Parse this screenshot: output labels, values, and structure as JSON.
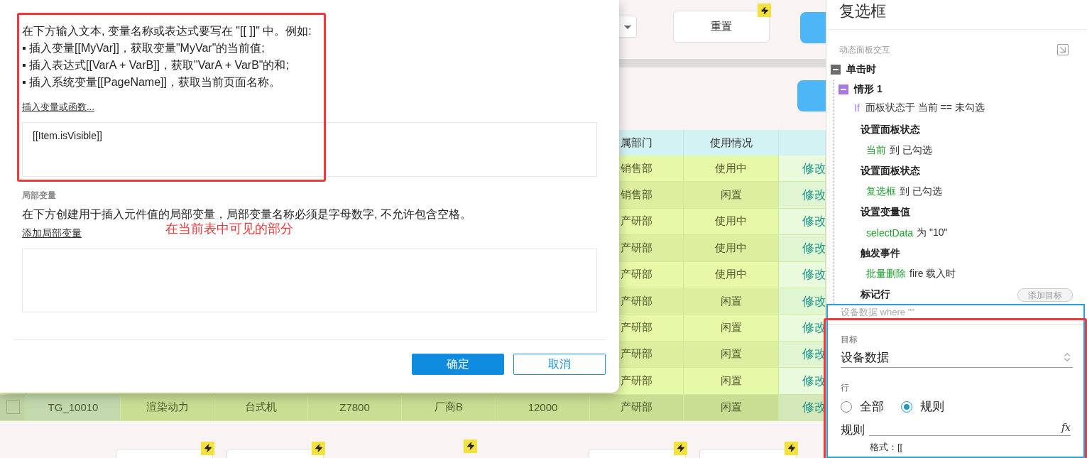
{
  "dialog": {
    "intro": [
      "在下方输入文本, 变量名称或表达式要写在 \"[[ ]]\" 中。例如:",
      "▪ 插入变量[[MyVar]]，获取变量\"MyVar\"的当前值;",
      "▪ 插入表达式[[VarA + VarB]]，获取\"VarA + VarB\"的和;",
      "▪ 插入系统变量[[PageName]]，获取当前页面名称。"
    ],
    "insert_link": "插入变量或函数...",
    "expression": "[[Item.isVisible]]",
    "local_vars_heading": "局部变量",
    "local_vars_desc": "在下方创建用于插入元件值的局部变量，局部变量名称必须是字母数字, 不允许包含空格。",
    "add_local_link": "添加局部变量",
    "buttons": [
      {
        "label": "确定",
        "kind": "primary"
      },
      {
        "label": "取消",
        "kind": "secondary"
      }
    ]
  },
  "annotation": "在当前表中可见的部分",
  "background": {
    "reset_button": "重置",
    "table": {
      "columns": [
        "属部门",
        "使用情况"
      ],
      "rows": [
        {
          "dept": "销售部",
          "status": "使用中",
          "action": "修改"
        },
        {
          "dept": "销售部",
          "status": "闲置",
          "action": "修改"
        },
        {
          "dept": "产研部",
          "status": "使用中",
          "action": "修改"
        },
        {
          "dept": "产研部",
          "status": "使用中",
          "action": "修改"
        },
        {
          "dept": "产研部",
          "status": "使用中",
          "action": "修改"
        },
        {
          "dept": "产研部",
          "status": "闲置",
          "action": "修改"
        },
        {
          "dept": "产研部",
          "status": "闲置",
          "action": "修改"
        },
        {
          "dept": "产研部",
          "status": "闲置",
          "action": "修改"
        },
        {
          "dept": "产研部",
          "status": "闲置",
          "action": "修改"
        },
        {
          "checked": false,
          "id": "TG_10010",
          "name": "渲染动力",
          "type": "台式机",
          "model": "Z7800",
          "vendor": "厂商B",
          "price": "12000",
          "dept": "产研部",
          "status": "闲置",
          "action": "修改"
        }
      ]
    }
  },
  "panel": {
    "title": "复选框",
    "section": "动态面板交互",
    "event": {
      "label": "单击时",
      "expanded": true,
      "case": {
        "label": "情形 1",
        "expanded": true,
        "keyword": "If",
        "condition": "面板状态于 当前 == 未勾选",
        "actions": [
          {
            "title": "设置面板状态",
            "target": "当前",
            "detail": "到 已勾选"
          },
          {
            "title": "设置面板状态",
            "target": "复选框",
            "detail": "到 已勾选"
          },
          {
            "title": "设置变量值",
            "target": "selectData",
            "detail": "为 \"10\""
          },
          {
            "title": "触发事件",
            "target": "批量删除",
            "detail": "fire 载入时"
          }
        ],
        "mark_row": {
          "title": "标记行",
          "button": "添加目标"
        }
      }
    },
    "editor": {
      "summary": "设备数据 where \"\"",
      "target_label": "目标",
      "target_value": "设备数据",
      "rows_label": "行",
      "rows_options": [
        {
          "label": "全部",
          "selected": false
        },
        {
          "label": "规则",
          "selected": true
        }
      ],
      "rule_label": "规则",
      "rule_icon": "fx",
      "rule_hint": "格式：[["
    }
  }
}
